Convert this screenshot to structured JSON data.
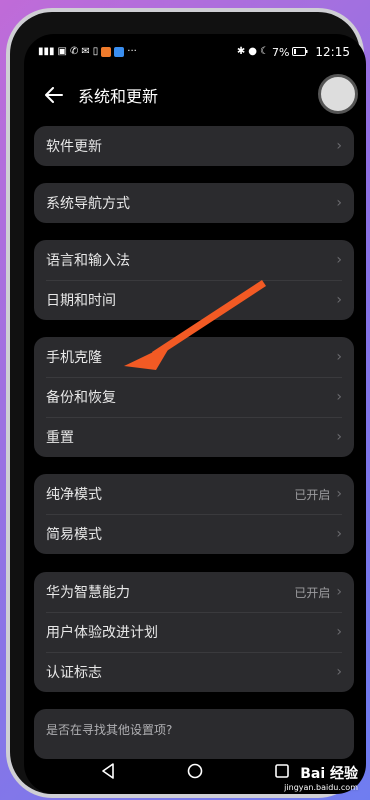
{
  "statusbar": {
    "battery": "7%",
    "time": "12:15",
    "app_colors": [
      "#f07b2c",
      "#3a8ef0"
    ]
  },
  "header": {
    "title": "系统和更新"
  },
  "groups": [
    {
      "items": [
        {
          "label": "软件更新"
        }
      ]
    },
    {
      "items": [
        {
          "label": "系统导航方式"
        }
      ]
    },
    {
      "items": [
        {
          "label": "语言和输入法"
        },
        {
          "label": "日期和时间"
        }
      ]
    },
    {
      "items": [
        {
          "label": "手机克隆"
        },
        {
          "label": "备份和恢复"
        },
        {
          "label": "重置"
        }
      ]
    },
    {
      "items": [
        {
          "label": "纯净模式",
          "value": "已开启"
        },
        {
          "label": "简易模式"
        }
      ]
    },
    {
      "items": [
        {
          "label": "华为智慧能力",
          "value": "已开启"
        },
        {
          "label": "用户体验改进计划"
        },
        {
          "label": "认证标志"
        }
      ]
    }
  ],
  "footer_hint": "是否在寻找其他设置项?",
  "annotation": {
    "color": "#f25a24"
  },
  "watermark": {
    "main": "Bai 经验",
    "sub": "jingyan.baidu.com"
  }
}
